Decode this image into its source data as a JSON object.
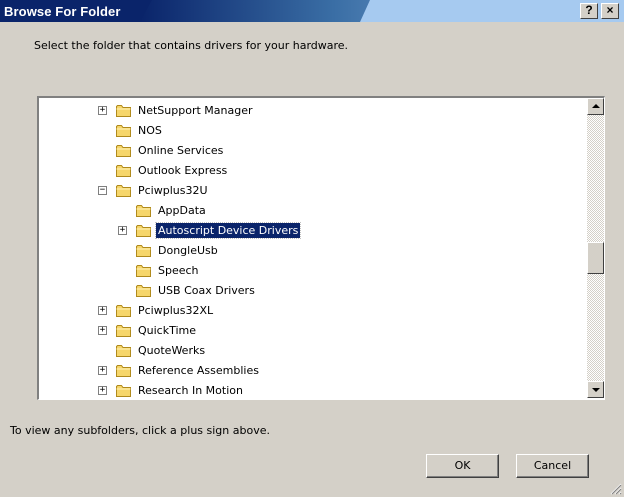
{
  "window": {
    "title": "Browse For Folder",
    "help_button": "?",
    "close_button": "×"
  },
  "instruction": "Select the folder that contains drivers for your hardware.",
  "tree": {
    "items": [
      {
        "label": "NetSupport Manager",
        "expander": "+",
        "level": 1
      },
      {
        "label": "NOS",
        "expander": "",
        "level": 1
      },
      {
        "label": "Online Services",
        "expander": "",
        "level": 1
      },
      {
        "label": "Outlook Express",
        "expander": "",
        "level": 1
      },
      {
        "label": "Pciwplus32U",
        "expander": "−",
        "level": 1
      },
      {
        "label": "AppData",
        "expander": "",
        "level": 2
      },
      {
        "label": "Autoscript Device Drivers",
        "expander": "+",
        "level": 2,
        "selected": true
      },
      {
        "label": "DongleUsb",
        "expander": "",
        "level": 2
      },
      {
        "label": "Speech",
        "expander": "",
        "level": 2
      },
      {
        "label": "USB Coax Drivers",
        "expander": "",
        "level": 2
      },
      {
        "label": "Pciwplus32XL",
        "expander": "+",
        "level": 1
      },
      {
        "label": "QuickTime",
        "expander": "+",
        "level": 1
      },
      {
        "label": "QuoteWerks",
        "expander": "",
        "level": 1
      },
      {
        "label": "Reference Assemblies",
        "expander": "+",
        "level": 1
      },
      {
        "label": "Research In Motion",
        "expander": "+",
        "level": 1
      }
    ]
  },
  "hint": "To view any subfolders, click a plus sign above.",
  "buttons": {
    "ok": "OK",
    "cancel": "Cancel"
  },
  "colors": {
    "title_bar": "#0a246a",
    "selection": "#0a246a",
    "dialog_bg": "#d4d0c8",
    "folder_fill": "#f6d66b"
  }
}
